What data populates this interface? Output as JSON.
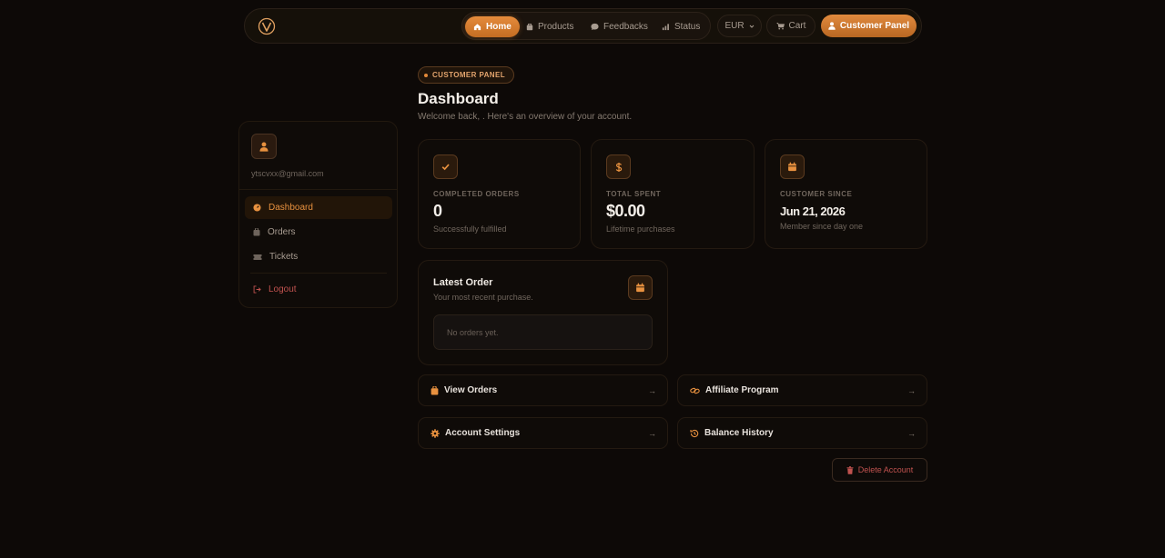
{
  "nav": {
    "links": [
      {
        "label": "Home",
        "icon": "home-icon",
        "active": true
      },
      {
        "label": "Products",
        "icon": "products-icon"
      },
      {
        "label": "Feedbacks",
        "icon": "feedbacks-icon"
      },
      {
        "label": "Status",
        "icon": "status-icon"
      }
    ],
    "currency": "EUR",
    "cart_label": "Cart",
    "panel_label": "Customer Panel"
  },
  "sidebar": {
    "email": "ytscvxx@gmail.com",
    "items": [
      {
        "label": "Dashboard",
        "icon": "dashboard-icon",
        "active": true
      },
      {
        "label": "Orders",
        "icon": "orders-icon"
      },
      {
        "label": "Tickets",
        "icon": "tickets-icon"
      }
    ],
    "logout_label": "Logout"
  },
  "header": {
    "badge": "CUSTOMER PANEL",
    "title": "Dashboard",
    "subtitle": "Welcome back, . Here's an overview of your account."
  },
  "stats": [
    {
      "label": "COMPLETED ORDERS",
      "value": "0",
      "sub": "Successfully fulfilled",
      "icon": "check-icon"
    },
    {
      "label": "TOTAL SPENT",
      "value": "$0.00",
      "sub": "Lifetime purchases",
      "icon": "dollar-icon"
    },
    {
      "label": "CUSTOMER SINCE",
      "value": "Jun 21, 2026",
      "sub": "Member since day one",
      "icon": "calendar-icon"
    }
  ],
  "latest_order": {
    "title": "Latest Order",
    "subtitle": "Your most recent purchase.",
    "empty_text": "No orders yet."
  },
  "actions": [
    {
      "label": "View Orders",
      "icon": "bag-icon"
    },
    {
      "label": "Affiliate Program",
      "icon": "link-icon"
    },
    {
      "label": "Account Settings",
      "icon": "gear-icon"
    },
    {
      "label": "Balance History",
      "icon": "history-icon"
    }
  ],
  "delete_label": "Delete Account",
  "colors": {
    "accent": "#e38a3a",
    "background": "#0d0907",
    "danger": "#c0524f"
  }
}
